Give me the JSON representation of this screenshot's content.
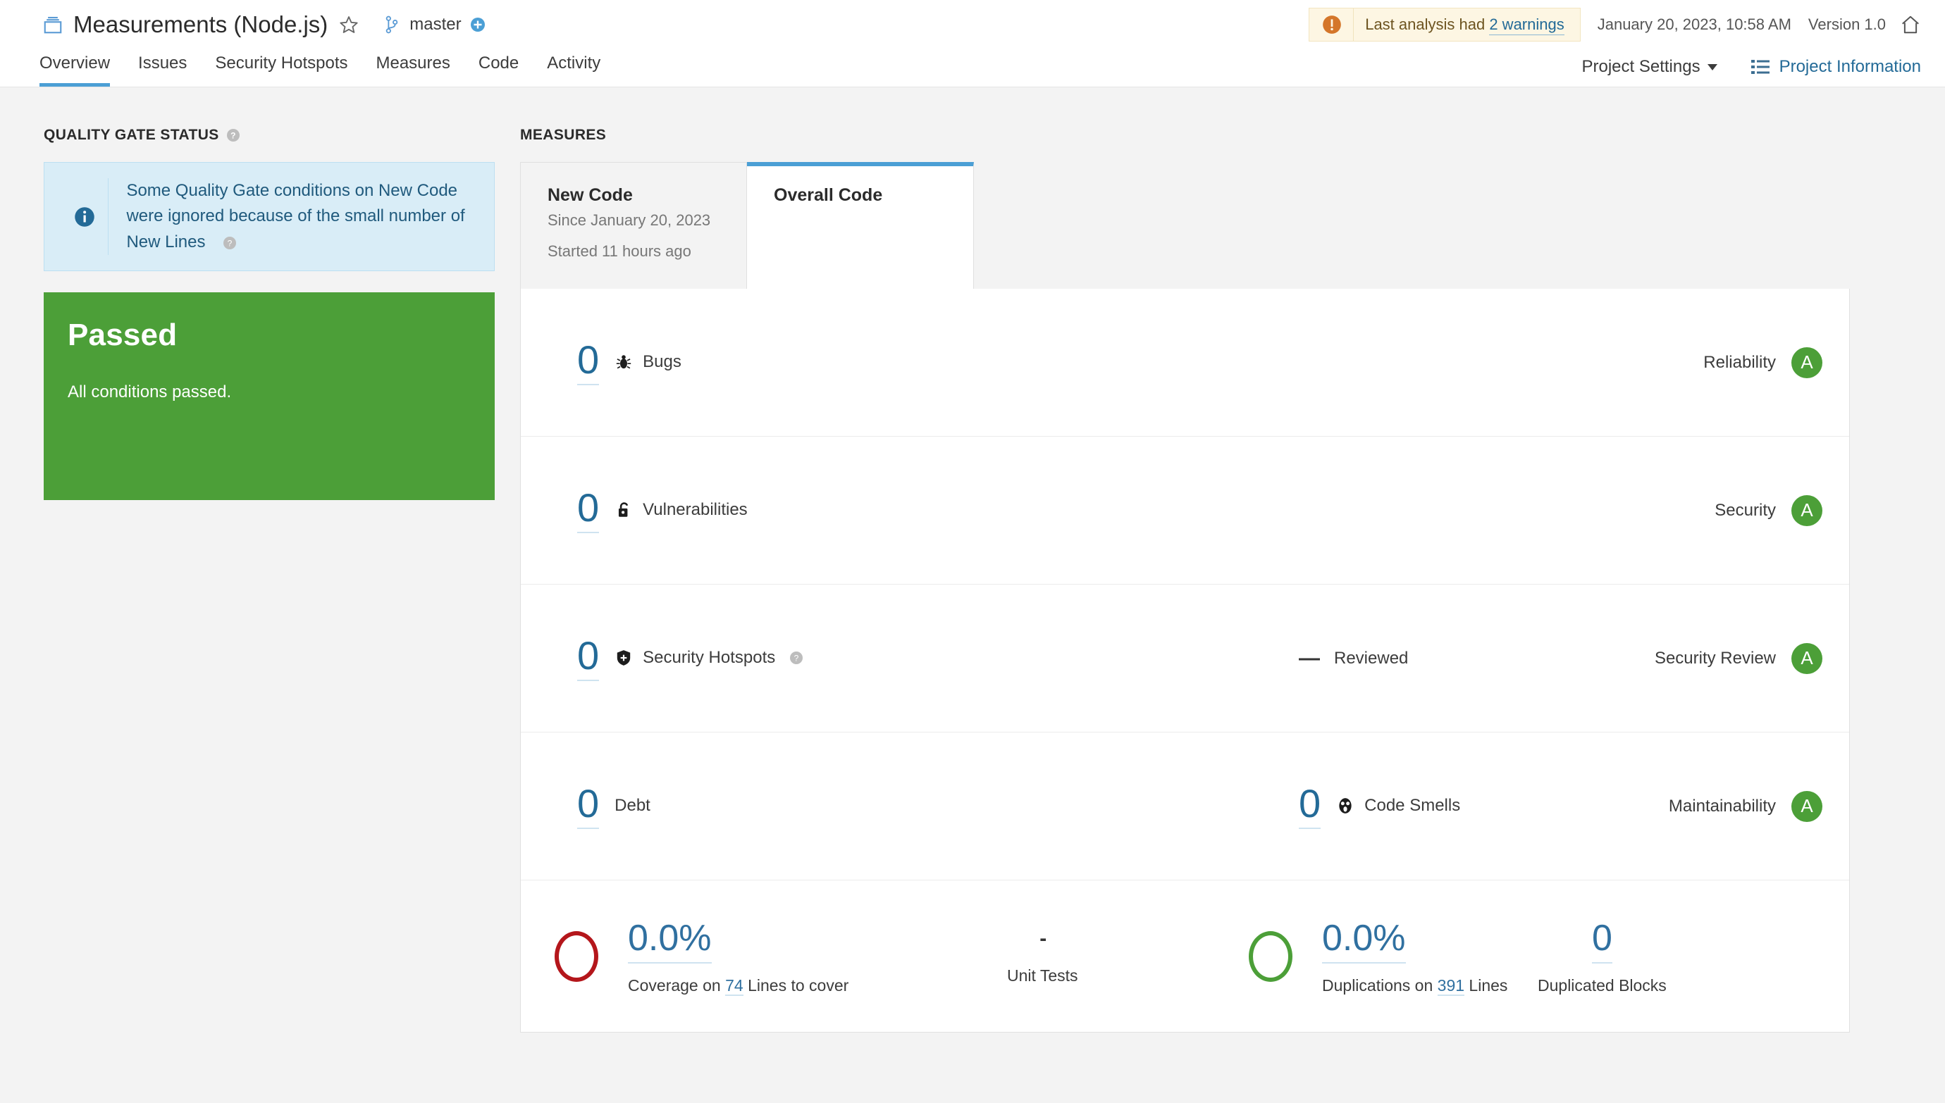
{
  "header": {
    "project_icon": "project-box-icon",
    "project_name": "Measurements (Node.js)",
    "favorite_icon": "star-icon",
    "branch_icon": "branch-icon",
    "branch_name": "master",
    "branch_add_icon": "plus-circle-icon",
    "warning_icon": "alert-circle-icon",
    "warning_prefix": "Last analysis had",
    "warning_link": "2 warnings",
    "analysis_date": "January 20, 2023, 10:58 AM",
    "version": "Version 1.0",
    "home_icon": "home-icon"
  },
  "nav": {
    "items": [
      {
        "label": "Overview",
        "active": true
      },
      {
        "label": "Issues",
        "active": false
      },
      {
        "label": "Security Hotspots",
        "active": false
      },
      {
        "label": "Measures",
        "active": false
      },
      {
        "label": "Code",
        "active": false
      },
      {
        "label": "Activity",
        "active": false
      }
    ],
    "project_settings": "Project Settings",
    "project_settings_icon": "chevron-down-icon",
    "project_information": "Project Information",
    "project_information_icon": "list-icon"
  },
  "quality_gate": {
    "section_title": "QUALITY GATE STATUS",
    "section_help_icon": "help-icon",
    "notice_icon": "info-circle-icon",
    "notice_text": "Some Quality Gate conditions on New Code were ignored because of the small number of New Lines",
    "notice_help_icon": "help-icon",
    "status": "Passed",
    "status_detail": "All conditions passed.",
    "status_color": "#4c9f38"
  },
  "measures": {
    "section_title": "MEASURES",
    "tabs": [
      {
        "title": "New Code",
        "line1": "Since January 20, 2023",
        "line2": "Started 11 hours ago",
        "active": false
      },
      {
        "title": "Overall Code",
        "line1": "",
        "line2": "",
        "active": true
      }
    ],
    "rows": [
      {
        "value": "0",
        "icon": "bug-icon",
        "label": "Bugs",
        "second_value": "",
        "second_label": "",
        "rating_name": "Reliability",
        "rating": "A",
        "rating_color": "#4c9f38"
      },
      {
        "value": "0",
        "icon": "vulnerability-lock-icon",
        "label": "Vulnerabilities",
        "second_value": "",
        "second_label": "",
        "rating_name": "Security",
        "rating": "A",
        "rating_color": "#4c9f38"
      },
      {
        "value": "0",
        "icon": "security-hotspot-shield-icon",
        "label": "Security Hotspots",
        "label_help_icon": "help-icon",
        "second_value": "—",
        "second_label": "Reviewed",
        "rating_name": "Security Review",
        "rating": "A",
        "rating_color": "#4c9f38"
      },
      {
        "value": "0",
        "icon": "",
        "label": "Debt",
        "second_value": "0",
        "second_icon": "code-smell-icon",
        "second_label": "Code Smells",
        "rating_name": "Maintainability",
        "rating": "A",
        "rating_color": "#4c9f38"
      }
    ],
    "coverage": {
      "donut_color": "#b4161b",
      "percent": "0.0%",
      "caption_prefix": "Coverage on",
      "caption_link": "74",
      "caption_suffix": "Lines to cover",
      "unit_tests_value": "-",
      "unit_tests_label": "Unit Tests"
    },
    "duplications": {
      "donut_color": "#4c9f38",
      "percent": "0.0%",
      "caption_prefix": "Duplications on",
      "caption_link": "391",
      "caption_suffix": "Lines",
      "blocks_value": "0",
      "blocks_label": "Duplicated Blocks"
    }
  }
}
